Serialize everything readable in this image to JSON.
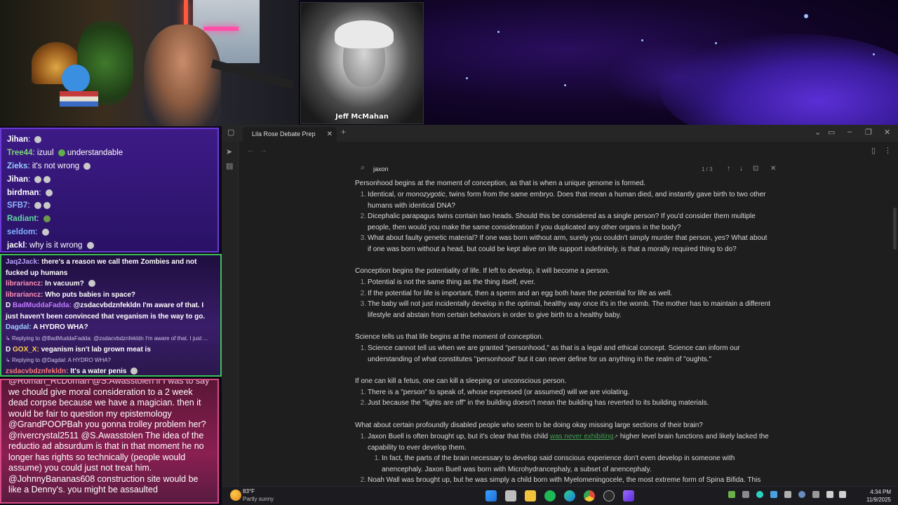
{
  "stream": {
    "guest_caption": "Jeff McMahan"
  },
  "chat1": [
    {
      "user": "Jihan",
      "color": "#ffffff",
      "text": ""
    },
    {
      "user": "Tree44",
      "color": "#7fd47a",
      "text": "izuul",
      "text2": "understandable"
    },
    {
      "user": "Zieks",
      "color": "#9ad0ff",
      "text": "it's not wrong"
    },
    {
      "user": "Jihan",
      "color": "#ffffff",
      "text": ""
    },
    {
      "user": "birdman",
      "color": "#ffffff",
      "text": ""
    },
    {
      "user": "SFB7",
      "color": "#8fb7ff",
      "text": ""
    },
    {
      "user": "Radiant",
      "color": "#5fd9a0",
      "text": ""
    },
    {
      "user": "seldom",
      "color": "#7fb2ff",
      "text": ""
    },
    {
      "user": "jackl",
      "color": "#ffffff",
      "text": "why is it wrong"
    }
  ],
  "chat2": {
    "m1_user": "Jaq2Jack:",
    "m1_text": " there's a reason we call them Zombies and not fucked up humans",
    "m2_user": "librariancz:",
    "m2_text": " In vacuum?",
    "m3_user": "librariancz:",
    "m3_text": " Who puts babies in space?",
    "m4_badge": "D",
    "m4_user": "BadMuddaFadda:",
    "m4_text": " @zsdacvbdznfekldn I'm aware of that. I just haven't been convinced that veganism is the way to go.",
    "m5_user": "Dagdal:",
    "m5_text": " A HYDRO WHA?",
    "r1": "Replying to @BadMuddaFadda: @zsdacvbdznfekldn I'm aware of that. I just ...",
    "m6_badge": "D",
    "m6_user": "GOX_X:",
    "m6_text": " veganism isn't lab grown meat is",
    "r2": "Replying to @Dagdal: A HYDRO WHA?",
    "m7_user": "zsdacvbdznfekldn:",
    "m7_text": " It's a water penis"
  },
  "chat3": {
    "l0": "@Roman_RcDoman @S.Awasstolen if I was to say",
    "l1": "we chould give moral consideration to a 2 week",
    "l2": "dead corpse because we have a magician. then it",
    "l3": "would be fair to question my epistemology",
    "l4a": "@GrandPOOPBah",
    "l4b": " you gonna trolley problem her?",
    "l5a": "@rivercrystal2511",
    "l5b": " @S.Awasstolen The idea of the",
    "l6": "reductio ad absurdum is that in that moment he no",
    "l7": "longer has rights so technically (people would",
    "l8": "assume) you could just not treat him.",
    "l9a": "@JohnnyBananas608",
    "l9b": " construction site would be",
    "l10": "like a Denny's. you might be assaulted"
  },
  "app": {
    "tab_title": "Lila Rose Debate Prep",
    "tab_close": "✕",
    "new_tab": "+",
    "search_query": "jaxon",
    "search_count": "1 / 3"
  },
  "doc": {
    "p1": "Personhood begins at the moment of conception, as that is when a unique genome is formed.",
    "p1_i1a": "Identical, or ",
    "p1_i1b": "monozygotic",
    "p1_i1c": ", twins form from the same embryo. Does that mean a human died, and instantly gave birth to two other",
    "p1_i1d": "humans with identical DNA?",
    "p1_i2a": "Dicephalic parapagus twins contain two heads. Should this be considered as a single person? If you'd consider them multiple",
    "p1_i2b": "people, then would you make the same consideration if you duplicated any other organs in the body?",
    "p1_i3a": "What about faulty genetic material? If one was born without arm, surely you couldn't simply murder that person, yes? What about",
    "p1_i3b": "if one was born without a head, but could be kept alive on life support indefinitely, is that a morally required thing to do?",
    "p2": "Conception begins the potentiality of life. If left to develop, it will become a person.",
    "p2_i1": "Potential is not the same thing as the thing itself, ever.",
    "p2_i2": "If the potential for life is important, then a sperm and an egg both have the potential for life as well.",
    "p2_i3a": "The baby will not just incidentally develop in the optimal, healthy way once it's in the womb. The mother has to maintain a different",
    "p2_i3b": "lifestyle and abstain from certain behaviors in order to give birth to a healthy baby.",
    "p3": "Science tells us that life begins at the moment of conception.",
    "p3_i1a": "Science cannot tell us when we are granted \"personhood,\" as that is a legal and ethical concept. Science can inform our",
    "p3_i1b": "understanding of what constitutes \"personhood\" but it can never define for us anything in the realm of \"oughts.\"",
    "p4": "If one can kill a fetus, one can kill a sleeping or unconscious person.",
    "p4_i1": "There is a \"person\" to speak of, whose expressed (or assumed) will we are violating.",
    "p4_i2": "Just because the \"lights are off\" in the building doesn't mean the building has reverted to its building materials.",
    "p5": "What about certain profoundly disabled people who seem to be doing okay missing large sections of their brain?",
    "p5_i1a": "Jaxon Buell is often brought up, but it's clear that this child ",
    "p5_i1link": "was never exhibiting",
    "p5_i1b": " higher level brain functions and likely lacked the",
    "p5_i1c": "capability to ever develop them.",
    "p5_s1a": "In fact, the parts of the brain necessary to develop said conscious experience don't even develop in someone with",
    "p5_s1b": "anencephaly. Jaxon Buell was born with Microhydrancephaly, a subset of anencephaly.",
    "p5_i2": "Noah Wall was brought up, but he was simply a child born with Myelomeningocele, the most extreme form of Spina Bifida. This",
    "n1": "1.",
    "n2": "2.",
    "n3": "3."
  },
  "taskbar": {
    "temp": "83°F",
    "weather": "Partly sunny",
    "time": "4:34 PM",
    "date": "11/9/2025"
  },
  "colors": {
    "accent_link": "#3f9d52",
    "chat_green": "#3fbf5a",
    "chat_pink": "#d84a86",
    "chat_purple": "#6a3bd6"
  }
}
